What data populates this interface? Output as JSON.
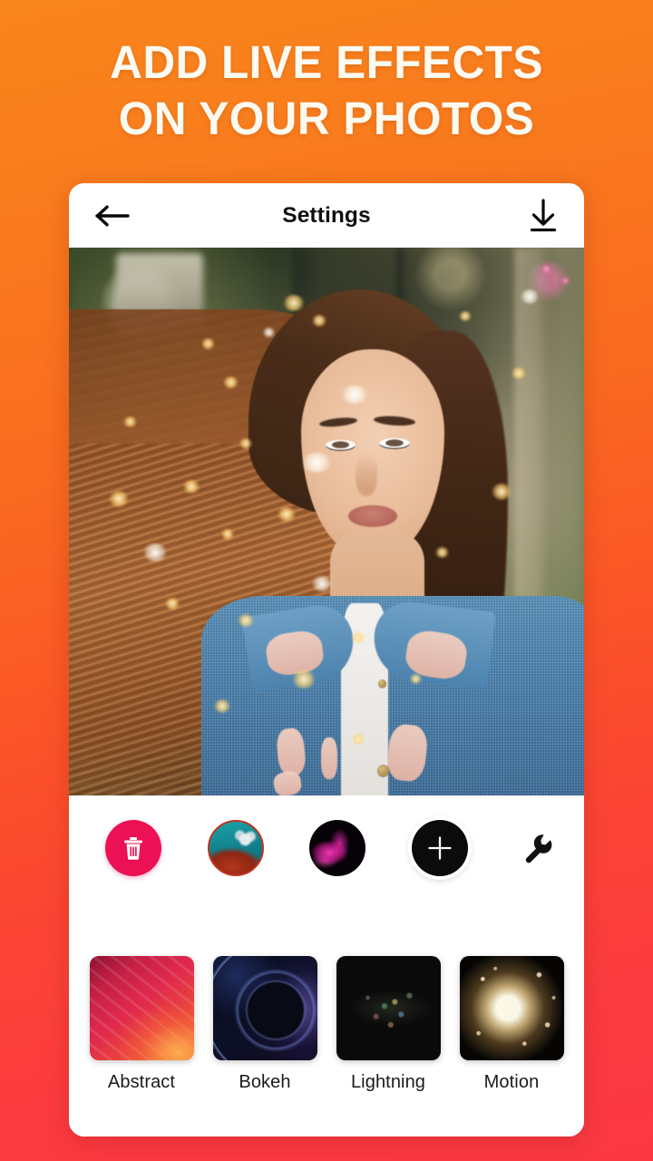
{
  "promo": {
    "headline_line1": "ADD LIVE EFFECTS",
    "headline_line2": "ON YOUR PHOTOS",
    "background_top_color": "#f9861c",
    "background_bottom_color": "#fb3744",
    "headline_color": "#fdfaf1"
  },
  "app_bar": {
    "title": "Settings",
    "back_icon": "arrow-left-icon",
    "download_icon": "download-icon"
  },
  "photo": {
    "alt": "woman with long flowing hair wearing distressed denim jacket",
    "overlay_effect": "golden bokeh sparkles"
  },
  "toolbar": {
    "delete_label": "Delete",
    "delete_icon": "trash-icon",
    "delete_color": "#ec1055",
    "add_label": "Add",
    "add_icon": "plus-icon",
    "add_color": "#0b0b0b",
    "settings_icon": "wrench-icon",
    "layers": [
      {
        "name": "coral-reef-effect",
        "selected": true
      },
      {
        "name": "neon-magenta-effect",
        "selected": false
      }
    ]
  },
  "gallery": {
    "items": [
      {
        "label": "Abstract",
        "thumb": "gt-abstract"
      },
      {
        "label": "Bokeh",
        "thumb": "gt-bokeh"
      },
      {
        "label": "Lightning",
        "thumb": "gt-lightning"
      },
      {
        "label": "Motion",
        "thumb": "gt-motion"
      }
    ]
  }
}
